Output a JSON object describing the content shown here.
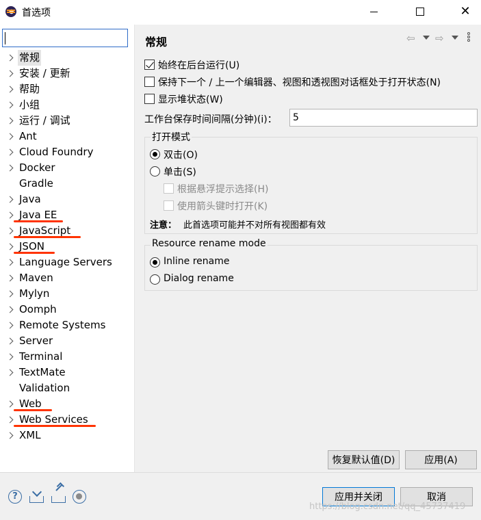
{
  "window": {
    "title": "首选项",
    "minimize_label": "—",
    "maximize_label": "☐",
    "close_label": "✕"
  },
  "filter": {
    "value": "",
    "placeholder": ""
  },
  "tree": {
    "items": [
      {
        "label": "常规",
        "expandable": true,
        "selected": true,
        "annotated": false
      },
      {
        "label": "安装 / 更新",
        "expandable": true,
        "selected": false,
        "annotated": false
      },
      {
        "label": "帮助",
        "expandable": true,
        "selected": false,
        "annotated": false
      },
      {
        "label": "小组",
        "expandable": true,
        "selected": false,
        "annotated": false
      },
      {
        "label": "运行 / 调试",
        "expandable": true,
        "selected": false,
        "annotated": false
      },
      {
        "label": "Ant",
        "expandable": true,
        "selected": false,
        "annotated": false
      },
      {
        "label": "Cloud Foundry",
        "expandable": true,
        "selected": false,
        "annotated": false
      },
      {
        "label": "Docker",
        "expandable": true,
        "selected": false,
        "annotated": false
      },
      {
        "label": "Gradle",
        "expandable": false,
        "selected": false,
        "annotated": false
      },
      {
        "label": "Java",
        "expandable": true,
        "selected": false,
        "annotated": false
      },
      {
        "label": "Java EE",
        "expandable": true,
        "selected": false,
        "annotated": true
      },
      {
        "label": "JavaScript",
        "expandable": true,
        "selected": false,
        "annotated": true
      },
      {
        "label": "JSON",
        "expandable": true,
        "selected": false,
        "annotated": true
      },
      {
        "label": "Language Servers",
        "expandable": true,
        "selected": false,
        "annotated": false
      },
      {
        "label": "Maven",
        "expandable": true,
        "selected": false,
        "annotated": false
      },
      {
        "label": "Mylyn",
        "expandable": true,
        "selected": false,
        "annotated": false
      },
      {
        "label": "Oomph",
        "expandable": true,
        "selected": false,
        "annotated": false
      },
      {
        "label": "Remote Systems",
        "expandable": true,
        "selected": false,
        "annotated": false
      },
      {
        "label": "Server",
        "expandable": true,
        "selected": false,
        "annotated": false
      },
      {
        "label": "Terminal",
        "expandable": true,
        "selected": false,
        "annotated": false
      },
      {
        "label": "TextMate",
        "expandable": true,
        "selected": false,
        "annotated": false
      },
      {
        "label": "Validation",
        "expandable": false,
        "selected": false,
        "annotated": false
      },
      {
        "label": "Web",
        "expandable": true,
        "selected": false,
        "annotated": true
      },
      {
        "label": "Web Services",
        "expandable": true,
        "selected": false,
        "annotated": true
      },
      {
        "label": "XML",
        "expandable": true,
        "selected": false,
        "annotated": false
      }
    ]
  },
  "annotation_color": "#ff3300",
  "page": {
    "title": "常规",
    "nav": {
      "back_glyph": "⇦",
      "forward_glyph": "⇨"
    },
    "checkboxes": [
      {
        "label": "始终在后台运行(U)",
        "checked": true
      },
      {
        "label": "保持下一个 / 上一个编辑器、视图和透视图对话框处于打开状态(N)",
        "checked": false
      },
      {
        "label": "显示堆状态(W)",
        "checked": false
      }
    ],
    "interval": {
      "label": "工作台保存时间间隔(分钟)(i)：",
      "value": "5"
    },
    "open_mode": {
      "title": "打开模式",
      "radios": [
        {
          "label": "双击(O)",
          "checked": true
        },
        {
          "label": "单击(S)",
          "checked": false
        }
      ],
      "sub_options": [
        {
          "label": "根据悬浮提示选择(H)",
          "checked": false,
          "enabled": false
        },
        {
          "label": "使用箭头键时打开(K)",
          "checked": false,
          "enabled": false
        }
      ],
      "note_label": "注意：",
      "note_text": "此首选项可能并不对所有视图都有效"
    },
    "rename_mode": {
      "title": "Resource rename mode",
      "radios": [
        {
          "label": "Inline rename",
          "checked": true
        },
        {
          "label": "Dialog rename",
          "checked": false
        }
      ]
    },
    "restore_defaults_label": "恢复默认值(D)",
    "apply_label": "应用(A)"
  },
  "footer": {
    "help_glyph": "?",
    "apply_close_label": "应用并关闭",
    "cancel_label": "取消"
  },
  "watermark": "https://blog.csdn.net/qq_45737419"
}
